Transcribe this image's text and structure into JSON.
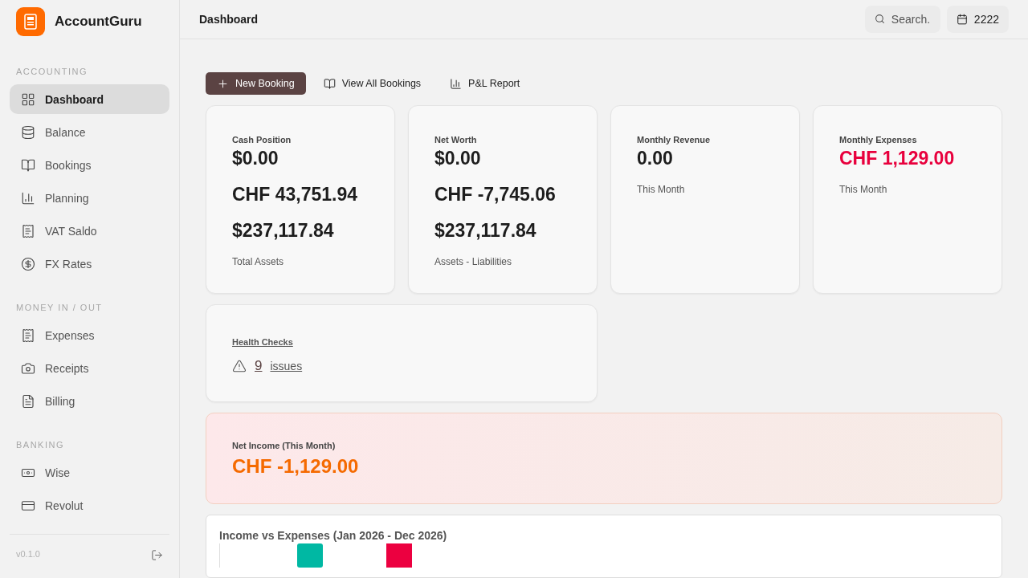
{
  "app": {
    "name": "AccountGuru"
  },
  "sidebar": {
    "sections": [
      {
        "heading": "ACCOUNTING",
        "items": [
          {
            "label": "Dashboard",
            "selected": true
          },
          {
            "label": "Balance",
            "selected": false
          },
          {
            "label": "Bookings",
            "selected": false
          },
          {
            "label": "Planning",
            "selected": false
          },
          {
            "label": "VAT Saldo",
            "selected": false
          },
          {
            "label": "FX Rates",
            "selected": false
          }
        ]
      },
      {
        "heading": "MONEY IN / OUT",
        "items": [
          {
            "label": "Expenses",
            "selected": false
          },
          {
            "label": "Receipts",
            "selected": false
          },
          {
            "label": "Billing",
            "selected": false
          }
        ]
      },
      {
        "heading": "BANKING",
        "items": [
          {
            "label": "Wise",
            "selected": false
          },
          {
            "label": "Revolut",
            "selected": false
          }
        ]
      }
    ],
    "version": "v0.1.0"
  },
  "header": {
    "title": "Dashboard",
    "search": {
      "placeholder": "Search."
    },
    "year": "2222"
  },
  "actions": [
    {
      "label": "New Booking",
      "kind": "primary"
    },
    {
      "label": "View All Bookings",
      "kind": "plain"
    },
    {
      "label": "P&L Report",
      "kind": "plain"
    }
  ],
  "cards": [
    {
      "label": "Cash Position",
      "values": [
        {
          "text": "$0.00",
          "color": "#1d1d1d"
        },
        {
          "text": "CHF 43,751.94",
          "color": "#1d1d1d"
        },
        {
          "text": "$237,117.84",
          "color": "#1d1d1d"
        }
      ],
      "caption": "Total Assets"
    },
    {
      "label": "Net Worth",
      "values": [
        {
          "text": "$0.00",
          "color": "#1d1d1d"
        },
        {
          "text": "CHF -7,745.06",
          "color": "#1d1d1d"
        },
        {
          "text": "$237,117.84",
          "color": "#1d1d1d"
        }
      ],
      "caption": "Assets - Liabilities"
    },
    {
      "label": "Monthly Revenue",
      "values": [
        {
          "text": "0.00",
          "color": "#1d1d1d"
        }
      ],
      "caption": "This Month"
    },
    {
      "label": "Monthly Expenses",
      "values": [
        {
          "text": "CHF 1,129.00",
          "color": "#e8003d"
        }
      ],
      "caption": "This Month"
    }
  ],
  "health": {
    "label": "Health Checks",
    "count": "9",
    "unit": "issues"
  },
  "net_income": {
    "label": "Net Income (This Month)",
    "value": "CHF -1,129.00"
  },
  "chart": {
    "title": "Income vs Expenses (Jan 2026 - Dec 2026)"
  }
}
